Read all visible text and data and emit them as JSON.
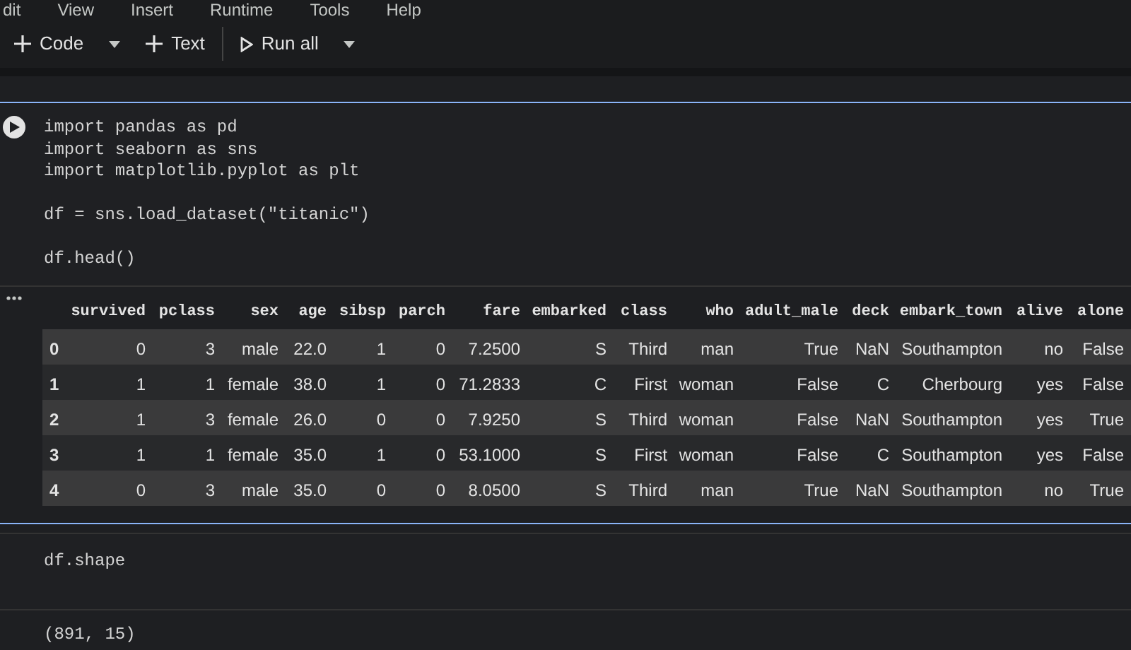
{
  "menu": [
    "dit",
    "View",
    "Insert",
    "Runtime",
    "Tools",
    "Help"
  ],
  "toolbar": [
    {
      "kind": "add",
      "label": "Code",
      "dropdown": true
    },
    {
      "kind": "add",
      "label": "Text",
      "dropdown": false
    },
    {
      "kind": "run",
      "label": "Run all",
      "dropdown": true
    }
  ],
  "cells": [
    {
      "code": "import pandas as pd\nimport seaborn as sns\nimport matplotlib.pyplot as plt\n\ndf = sns.load_dataset(\"titanic\")\n\ndf.head()",
      "output": {
        "kind": "table",
        "columns": [
          "survived",
          "pclass",
          "sex",
          "age",
          "sibsp",
          "parch",
          "fare",
          "embarked",
          "class",
          "who",
          "adult_male",
          "deck",
          "embark_town",
          "alive",
          "alone"
        ],
        "rows": [
          {
            "index": "0",
            "cells": [
              "0",
              "3",
              "male",
              "22.0",
              "1",
              "0",
              "7.2500",
              "S",
              "Third",
              "man",
              "True",
              "NaN",
              "Southampton",
              "no",
              "False"
            ]
          },
          {
            "index": "1",
            "cells": [
              "1",
              "1",
              "female",
              "38.0",
              "1",
              "0",
              "71.2833",
              "C",
              "First",
              "woman",
              "False",
              "C",
              "Cherbourg",
              "yes",
              "False"
            ]
          },
          {
            "index": "2",
            "cells": [
              "1",
              "3",
              "female",
              "26.0",
              "0",
              "0",
              "7.9250",
              "S",
              "Third",
              "woman",
              "False",
              "NaN",
              "Southampton",
              "yes",
              "True"
            ]
          },
          {
            "index": "3",
            "cells": [
              "1",
              "1",
              "female",
              "35.0",
              "1",
              "0",
              "53.1000",
              "S",
              "First",
              "woman",
              "False",
              "C",
              "Southampton",
              "yes",
              "False"
            ]
          },
          {
            "index": "4",
            "cells": [
              "0",
              "3",
              "male",
              "35.0",
              "0",
              "0",
              "8.0500",
              "S",
              "Third",
              "man",
              "True",
              "NaN",
              "Southampton",
              "no",
              "True"
            ]
          }
        ]
      }
    },
    {
      "code": "df.shape",
      "output": {
        "kind": "text",
        "text": "(891, 15)"
      }
    }
  ]
}
